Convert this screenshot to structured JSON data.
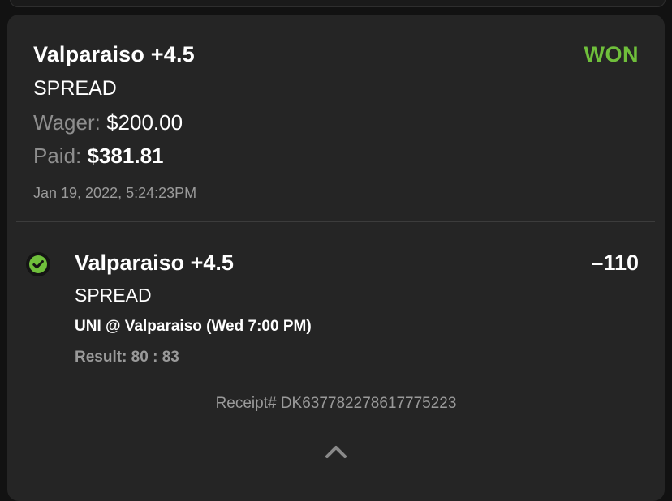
{
  "bet": {
    "title": "Valparaiso +4.5",
    "status": "WON",
    "type": "SPREAD",
    "wager_label": "Wager:",
    "wager_value": "$200.00",
    "paid_label": "Paid:",
    "paid_value": "$381.81",
    "timestamp": "Jan 19, 2022, 5:24:23PM"
  },
  "leg": {
    "title": "Valparaiso +4.5",
    "odds": "–110",
    "type": "SPREAD",
    "event": "UNI @ Valparaiso (Wed 7:00 PM)",
    "result": "Result: 80 : 83"
  },
  "receipt": "Receipt# DK637782278617775223",
  "colors": {
    "won": "#6fbf3b",
    "background": "#121212",
    "card": "#252525"
  },
  "icons": {
    "leg_status": "check-circle-icon",
    "collapse": "chevron-up-icon"
  }
}
